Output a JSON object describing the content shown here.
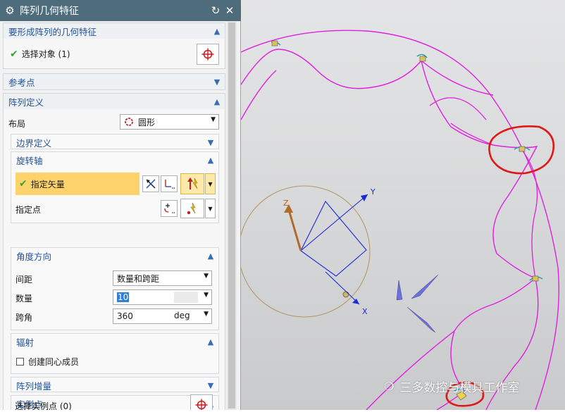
{
  "dialog": {
    "title": "阵列几何特征",
    "refresh_icon": "refresh-icon",
    "close_icon": "close-icon"
  },
  "geometry_section": {
    "header": "要形成阵列的几何特征",
    "select_object": "选择对象 (1)",
    "select_button_icon": "crosshair-icon"
  },
  "reference_point": {
    "header": "参考点"
  },
  "array_definition": {
    "header": "阵列定义",
    "layout_label": "布局",
    "layout_value": "圆形",
    "boundary": {
      "header": "边界定义"
    },
    "rotation_axis": {
      "header": "旋转轴",
      "specify_vector": "指定矢量",
      "specify_point": "指定点"
    },
    "angle_direction": {
      "header": "角度方向",
      "spacing_label": "间距",
      "spacing_value": "数量和跨距",
      "count_label": "数量",
      "count_value": "10",
      "span_label": "跨角",
      "span_value": "360",
      "span_unit": "deg"
    },
    "radiate": {
      "header": "辐射",
      "create_concentric": "创建同心成员",
      "create_concentric_checked": false
    },
    "increment": {
      "header": "阵列增量"
    },
    "instance_points": {
      "header": "实例点",
      "select_instance": "选择实例点 (0)"
    }
  },
  "viewport": {
    "axis_x": "X",
    "axis_y": "Y",
    "axis_z": "Z"
  },
  "watermark": "三多数控与模具工作室",
  "colors": {
    "titlebar": "#4e6c7b",
    "section_header_text": "#24539a",
    "highlight_row": "#ffd36b",
    "curve": "#e020e0",
    "markup": "#e01818",
    "wcs": "#1a2adb"
  }
}
